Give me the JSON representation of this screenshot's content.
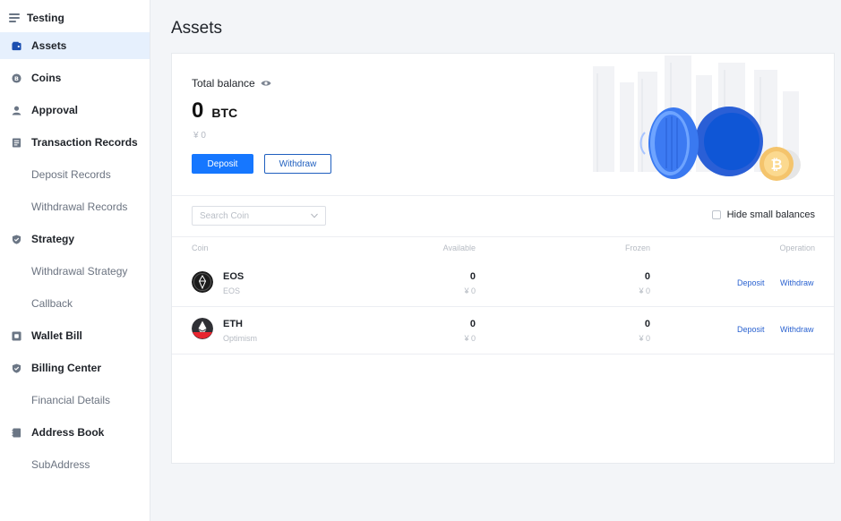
{
  "sidebar": {
    "title": "Testing",
    "items": [
      {
        "label": "Assets",
        "level": "top",
        "icon": "wallet-icon",
        "active": true
      },
      {
        "label": "Coins",
        "level": "top",
        "icon": "coin-icon"
      },
      {
        "label": "Approval",
        "level": "top",
        "icon": "user-icon"
      },
      {
        "label": "Transaction Records",
        "level": "top",
        "icon": "document-icon"
      },
      {
        "label": "Deposit Records",
        "level": "sub"
      },
      {
        "label": "Withdrawal Records",
        "level": "sub"
      },
      {
        "label": "Strategy",
        "level": "top",
        "icon": "shield-icon"
      },
      {
        "label": "Withdrawal Strategy",
        "level": "sub"
      },
      {
        "label": "Callback",
        "level": "sub"
      },
      {
        "label": "Wallet Bill",
        "level": "top",
        "icon": "bill-icon"
      },
      {
        "label": "Billing Center",
        "level": "top",
        "icon": "shield-check-icon"
      },
      {
        "label": "Financial Details",
        "level": "sub"
      },
      {
        "label": "Address Book",
        "level": "top",
        "icon": "book-icon"
      },
      {
        "label": "SubAddress",
        "level": "sub"
      }
    ]
  },
  "page": {
    "title": "Assets"
  },
  "balance": {
    "label": "Total balance",
    "amount": "0",
    "unit": "BTC",
    "fiat": "¥ 0",
    "deposit_label": "Deposit",
    "withdraw_label": "Withdraw"
  },
  "filters": {
    "search_placeholder": "Search Coin",
    "hide_small_label": "Hide small balances"
  },
  "table": {
    "columns": [
      "Coin",
      "Available",
      "Frozen",
      "Operation"
    ],
    "rows": [
      {
        "coin": "EOS",
        "network": "EOS",
        "available": "0",
        "available_fiat": "¥ 0",
        "frozen": "0",
        "frozen_fiat": "¥ 0",
        "op_deposit": "Deposit",
        "op_withdraw": "Withdraw"
      },
      {
        "coin": "ETH",
        "network": "Optimism",
        "available": "0",
        "available_fiat": "¥ 0",
        "frozen": "0",
        "frozen_fiat": "¥ 0",
        "op_deposit": "Deposit",
        "op_withdraw": "Withdraw"
      }
    ]
  },
  "colors": {
    "primary": "#1677ff",
    "sidebar_active": "#e6f0fd",
    "link": "#2a62d0"
  }
}
